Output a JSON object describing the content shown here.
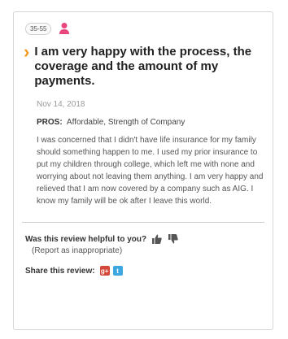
{
  "review": {
    "age_range": "35-55",
    "title": "I am very happy with the process, the coverage and the amount of my payments.",
    "date": "Nov 14, 2018",
    "pros_label": "PROS:",
    "pros_value": "Affordable, Strength of Company",
    "body": "I was concerned that I didn't have life insurance for my family should something happen to me. I used my prior insurance to put my children through college, which left me with none and worrying about not leaving them anything. I am very happy and relieved that I am now covered by a company such as AIG. I know my family will be ok after I leave this world."
  },
  "feedback": {
    "helpful_question": "Was this review helpful to you?",
    "report_link": "(Report as inappropriate)"
  },
  "share": {
    "label": "Share this review:",
    "gplus_glyph": "g+",
    "twitter_glyph": "t"
  },
  "colors": {
    "accent": "#f39a1e",
    "person_icon": "#e8467c"
  }
}
